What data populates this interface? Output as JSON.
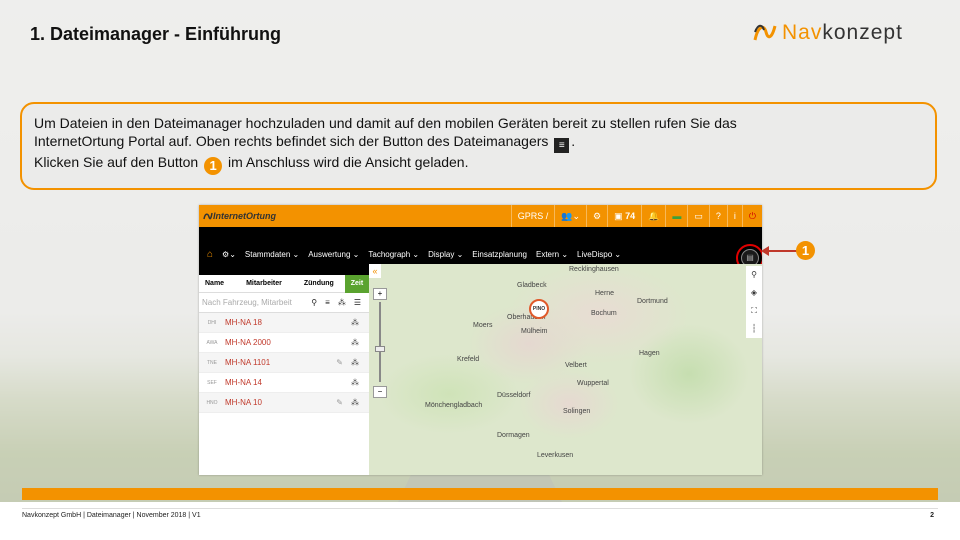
{
  "slide": {
    "title": "1. Dateimanager - Einführung",
    "logo_prefix": "Nav",
    "logo_suffix": "konzept"
  },
  "callout": {
    "line1": "Um Dateien in den Dateimanager hochzuladen und damit auf den mobilen Geräten bereit zu stellen rufen Sie das",
    "line2": "InternetOrtung Portal auf. Oben rechts befindet sich der Button des Dateimanagers",
    "line2_end": ".",
    "line3_start": "Klicken Sie auf den Button",
    "line3_badge": "1",
    "line3_end": "im Anschluss wird die Ansicht geladen.",
    "file_icon_glyph": "≡"
  },
  "app": {
    "brand": "InternetOrtung",
    "topbar": {
      "gprs": "GPRS /",
      "badge_count": "74"
    },
    "nav": [
      "Stammdaten ⌄",
      "Auswertung ⌄",
      "Tachograph ⌄",
      "Display ⌄",
      "Einsatzplanung",
      "Extern ⌄",
      "LiveDispo ⌄"
    ],
    "table_headers": {
      "name": "Name",
      "mitarbeiter": "Mitarbeiter",
      "zuendung": "Zündung",
      "zeit": "Zeit"
    },
    "search_placeholder": "Nach Fahrzeug, Mitarbeit",
    "vehicles": [
      {
        "code": "DHI",
        "name": "MH-NA 18"
      },
      {
        "code": "AWA",
        "name": "MH-NA 2000"
      },
      {
        "code": "TNE",
        "name": "MH-NA 1101"
      },
      {
        "code": "SEF",
        "name": "MH-NA 14"
      },
      {
        "code": "HNO",
        "name": "MH-NA 10"
      }
    ],
    "map": {
      "pin_label": "PINO",
      "cities": [
        "Recklinghausen",
        "Herne",
        "Dortmund",
        "Bochum",
        "Moers",
        "Oberhausen",
        "Mülheim",
        "Krefeld",
        "Wuppertal",
        "Hagen",
        "Mönchengladbach",
        "Düsseldorf",
        "Solingen",
        "Leverkusen",
        "Gladbeck",
        "Velbert",
        "Dormagen"
      ]
    },
    "step_badge": "1"
  },
  "footer": {
    "text": "Navkonzept GmbH  |  Dateimanager  |  November 2018  |  V1",
    "page": "2"
  },
  "colors": {
    "accent": "#f39200",
    "red": "#c0392b",
    "green": "#5aa32f"
  }
}
